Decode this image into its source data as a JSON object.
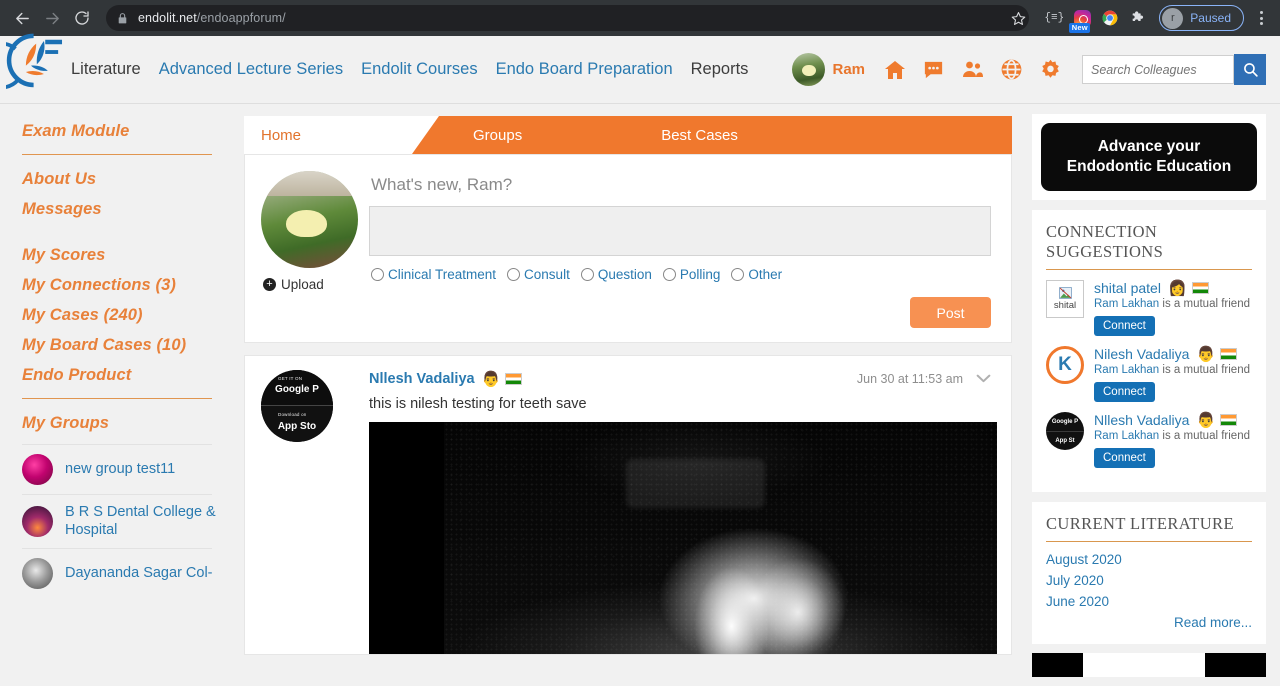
{
  "browser": {
    "back_icon": "back-arrow-icon",
    "forward_icon": "forward-arrow-icon",
    "reload_icon": "reload-icon",
    "lock_icon": "lock-icon",
    "url_domain": "endolit.net",
    "url_path": "/endoappforum/",
    "bookmark_icon": "star-icon",
    "extensions": [
      {
        "name": "reader-extension-icon",
        "glyph": "{≡}"
      },
      {
        "name": "instagram-extension-icon",
        "badge": "New"
      },
      {
        "name": "chrome-extension-icon"
      },
      {
        "name": "puzzle-extensions-icon"
      }
    ],
    "profile": {
      "initial": "r",
      "label": "Paused"
    },
    "menu_icon": "kebab-menu-icon"
  },
  "header": {
    "logo_alt": "endolit-logo",
    "nav": [
      {
        "label": "Literature",
        "style": "plain"
      },
      {
        "label": "Advanced Lecture Series",
        "style": "link"
      },
      {
        "label": "Endolit Courses",
        "style": "link"
      },
      {
        "label": "Endo Board Preparation",
        "style": "link"
      },
      {
        "label": "Reports",
        "style": "plain"
      }
    ],
    "user_name": "Ram",
    "icons": [
      "home-icon",
      "chat-icon",
      "friends-icon",
      "globe-icon",
      "gear-icon"
    ],
    "search_placeholder": "Search Colleagues",
    "search_value": "",
    "search_button_icon": "search-icon",
    "accent_orange": "#ef7b2e",
    "link_blue": "#2a7ab0",
    "search_button_blue": "#2f6fb5"
  },
  "sidebar": {
    "top_items": [
      {
        "label": "Exam Module"
      }
    ],
    "items": [
      {
        "label": "About Us"
      },
      {
        "label": "Messages"
      }
    ],
    "stats": [
      {
        "label": "My Scores"
      },
      {
        "label": "My Connections (3)"
      },
      {
        "label": "My Cases (240)"
      },
      {
        "label": "My Board Cases (10)"
      },
      {
        "label": "Endo Product"
      }
    ],
    "groups_title": "My Groups",
    "groups": [
      {
        "name": "new group test11",
        "avatar": "group-avatar-pink"
      },
      {
        "name": "B R S Dental College & Hospital",
        "avatar": "group-avatar-sunset"
      },
      {
        "name": "Dayananda Sagar Col-",
        "avatar": "group-avatar-gray"
      }
    ]
  },
  "tabs": [
    {
      "label": "Home",
      "active": true
    },
    {
      "label": "Groups",
      "active": false
    },
    {
      "label": "Best Cases",
      "active": false
    }
  ],
  "composer": {
    "prompt": "What's new, Ram?",
    "textarea_value": "",
    "upload_label": "Upload",
    "categories": [
      {
        "label": "Clinical Treatment",
        "selected": false
      },
      {
        "label": "Consult",
        "selected": false
      },
      {
        "label": "Question",
        "selected": false
      },
      {
        "label": "Polling",
        "selected": false
      },
      {
        "label": "Other",
        "selected": false
      }
    ],
    "post_button": "Post"
  },
  "feed": [
    {
      "author": "Nllesh Vadaliya",
      "flag": "india-flag-icon",
      "timestamp": "Jun 30 at 11:53 am",
      "text": "this is nilesh testing for teeth save",
      "avatar_top": "GET IT ON",
      "avatar_top_main": "Google P",
      "avatar_bottom": "Download on",
      "avatar_bottom_main": "App Sto",
      "media_alt": "dental-radiograph"
    }
  ],
  "right": {
    "ad": {
      "line1": "Advance your",
      "line2": "Endodontic Education"
    },
    "suggestions_title": "CONNECTION SUGGESTIONS",
    "suggestions": [
      {
        "name": "shital patel",
        "avatar_type": "broken-image",
        "avatar_text": "shital",
        "mutual_name": "Ram Lakhan",
        "mutual_suffix": " is a mutual friend",
        "connect_label": "Connect"
      },
      {
        "name": "Nilesh Vadaliya",
        "avatar_type": "k-logo",
        "avatar_text": "K",
        "mutual_name": "Ram Lakhan",
        "mutual_suffix": " is a mutual friend",
        "connect_label": "Connect"
      },
      {
        "name": "Nllesh Vadaliya",
        "avatar_type": "store-badges",
        "avatar_text": "Google P",
        "mutual_name": "Ram Lakhan",
        "mutual_suffix": " is a mutual friend",
        "connect_label": "Connect"
      }
    ],
    "literature_title": "CURRENT LITERATURE",
    "literature": [
      {
        "label": "August 2020"
      },
      {
        "label": "July 2020"
      },
      {
        "label": "June 2020"
      }
    ],
    "read_more": "Read more..."
  }
}
